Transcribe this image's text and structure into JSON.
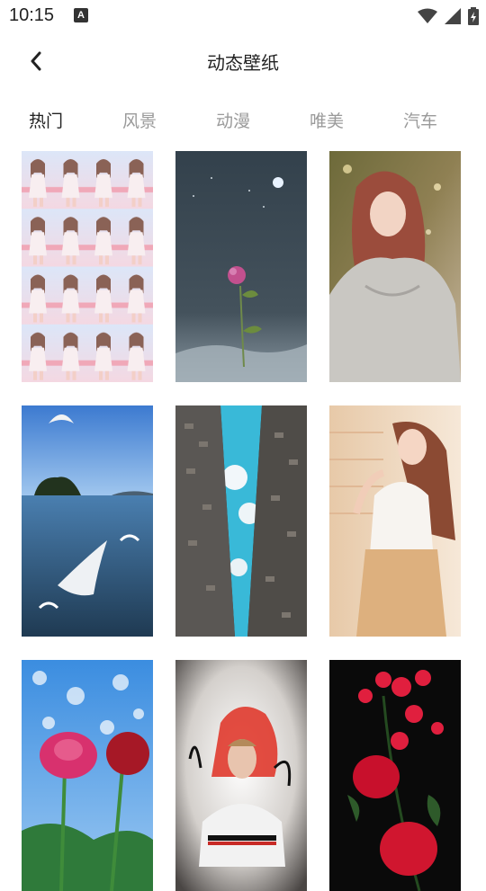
{
  "status_bar": {
    "time": "10:15",
    "notification_badge": "A"
  },
  "header": {
    "title": "动态壁纸"
  },
  "tabs": [
    {
      "label": "热门",
      "active": true
    },
    {
      "label": "风景",
      "active": false
    },
    {
      "label": "动漫",
      "active": false
    },
    {
      "label": "唯美",
      "active": false
    },
    {
      "label": "汽车",
      "active": false
    }
  ],
  "wallpapers": [
    {
      "theme": "girl-tiled-pink"
    },
    {
      "theme": "flower-night-sky"
    },
    {
      "theme": "girl-sweater-sunset"
    },
    {
      "theme": "seagulls-sea"
    },
    {
      "theme": "buildings-sky-looking-up"
    },
    {
      "theme": "girl-white-top"
    },
    {
      "theme": "pink-roses-blue-sky"
    },
    {
      "theme": "footballer-portrait"
    },
    {
      "theme": "red-roses-black"
    }
  ],
  "colors": {
    "active_tab": "#222222",
    "inactive_tab": "#9a9a9a"
  }
}
